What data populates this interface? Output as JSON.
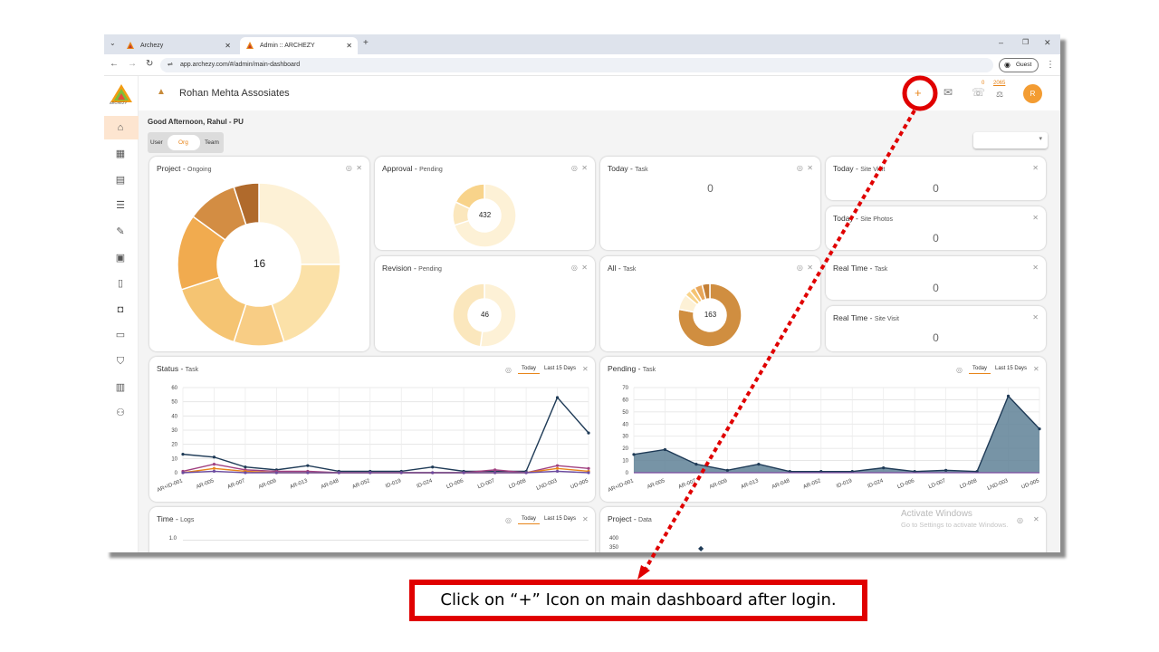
{
  "browser": {
    "tabs": [
      {
        "label": "Archezy"
      },
      {
        "label": "Admin :: ARCHEZY"
      }
    ],
    "url": "app.archezy.com/#/admin/main-dashboard",
    "profile_label": "Guest"
  },
  "app": {
    "logo_text": "ARCHEZY",
    "org_name": "Rohan Mehta Assosiates",
    "greeting": "Good Afternoon, Rahul - PU",
    "view_tabs": [
      "User",
      "Org",
      "Team"
    ],
    "active_view": "Org",
    "header": {
      "add_label": "+",
      "notif_count": "0",
      "coins_count": "2065",
      "avatar_initial": "R"
    }
  },
  "cards": {
    "project": {
      "title": "Project",
      "sub": "Ongoing",
      "center": "16"
    },
    "approval": {
      "title": "Approval",
      "sub": "Pending",
      "center": "432"
    },
    "revision": {
      "title": "Revision",
      "sub": "Pending",
      "center": "46"
    },
    "today_task": {
      "title": "Today",
      "sub": "Task",
      "value": "0"
    },
    "all_task": {
      "title": "All",
      "sub": "Task",
      "center": "163"
    },
    "today_site_visit": {
      "title": "Today",
      "sub": "Site Visit",
      "value": "0"
    },
    "today_site_photos": {
      "title": "Today",
      "sub": "Site Photos",
      "value": "0"
    },
    "realtime_task": {
      "title": "Real Time",
      "sub": "Task",
      "value": "0"
    },
    "realtime_site_visit": {
      "title": "Real Time",
      "sub": "Site Visit",
      "value": "0"
    },
    "status_task": {
      "title": "Status",
      "sub": "Task"
    },
    "pending_task": {
      "title": "Pending",
      "sub": "Task"
    },
    "time_logs": {
      "title": "Time",
      "sub": "Logs"
    },
    "project_data": {
      "title": "Project",
      "sub": "Data"
    }
  },
  "range_tabs": {
    "today": "Today",
    "last15": "Last 15 Days"
  },
  "watermark": {
    "line1": "Activate Windows",
    "line2": "Go to Settings to activate Windows."
  },
  "callout": {
    "text": "Click on “+” Icon on main dashboard after login."
  },
  "highlight_color": "#e00000",
  "accent_color": "#e8851a",
  "chart_data": [
    {
      "type": "line",
      "title": "Status - Task",
      "categories": [
        "AR+ID-001",
        "AR-005",
        "AR-007",
        "AR-009",
        "AR-013",
        "AR-048",
        "AR-052",
        "ID-019",
        "ID-024",
        "LD-006",
        "LD-007",
        "LD-008",
        "LND-003",
        "UD-005"
      ],
      "ylim": [
        0,
        60
      ],
      "yticks": [
        0,
        10,
        20,
        30,
        40,
        50,
        60
      ],
      "series": [
        {
          "color": "#1f3b57",
          "values": [
            13,
            11,
            4,
            2,
            5,
            1,
            1,
            1,
            4,
            1,
            1,
            1,
            53,
            28
          ]
        },
        {
          "color": "#a04080",
          "values": [
            1,
            6,
            2,
            1,
            1,
            0,
            0,
            0,
            0,
            0,
            2,
            0,
            5,
            3
          ]
        },
        {
          "color": "#e8851a",
          "values": [
            0,
            3,
            1,
            0,
            0,
            0,
            0,
            0,
            0,
            0,
            0,
            0,
            3,
            1
          ]
        },
        {
          "color": "#6b4aa0",
          "values": [
            0,
            1,
            0,
            0,
            0,
            0,
            0,
            0,
            0,
            0,
            0,
            0,
            1,
            0
          ]
        }
      ],
      "grid": true
    },
    {
      "type": "area",
      "title": "Pending - Task",
      "categories": [
        "AR+ID-001",
        "AR-005",
        "AR-007",
        "AR-009",
        "AR-013",
        "AR-048",
        "AR-052",
        "ID-019",
        "ID-024",
        "LD-006",
        "LD-007",
        "LD-008",
        "LND-003",
        "UD-005"
      ],
      "ylim": [
        0,
        70
      ],
      "yticks": [
        0,
        10,
        20,
        30,
        40,
        50,
        60,
        70
      ],
      "series": [
        {
          "color": "#1f3b57",
          "values": [
            15,
            19,
            7,
            2,
            7,
            1,
            1,
            1,
            4,
            1,
            2,
            1,
            63,
            36
          ]
        }
      ],
      "grid": true
    },
    {
      "type": "pie",
      "title": "Project - Ongoing",
      "values": [
        5,
        4,
        2,
        3,
        3,
        2,
        1
      ],
      "colors": [
        "#fdf1d6",
        "#fbe1a8",
        "#f8cd85",
        "#f5c472",
        "#f1ab4f",
        "#d38d43",
        "#b06a2c"
      ]
    },
    {
      "type": "pie",
      "title": "Approval - Pending",
      "values": [
        70,
        12,
        18
      ],
      "colors": [
        "#fdf1d6",
        "#fbe7bd",
        "#f8d38a"
      ]
    },
    {
      "type": "pie",
      "title": "Revision - Pending",
      "values": [
        52,
        48
      ],
      "colors": [
        "#fdf1d6",
        "#fbe7bd"
      ]
    },
    {
      "type": "pie",
      "title": "All - Task",
      "values": [
        78,
        8,
        3,
        3,
        4,
        4
      ],
      "colors": [
        "#d08e40",
        "#fdf1d6",
        "#f8d38a",
        "#f5c472",
        "#e8a65a",
        "#c47f35"
      ]
    }
  ]
}
